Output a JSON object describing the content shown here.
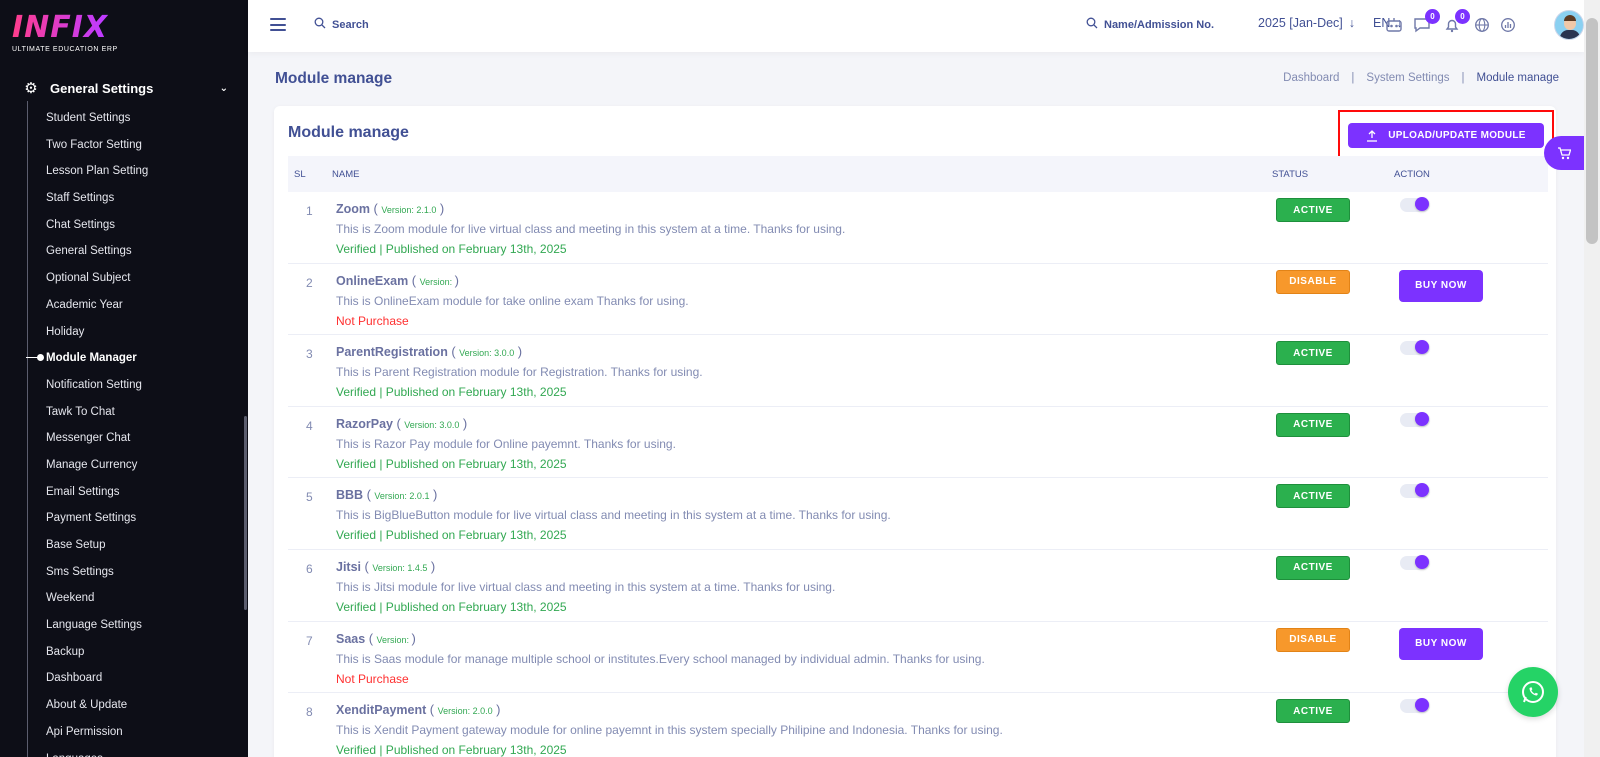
{
  "app": {
    "logo_text": "INFIX",
    "logo_subtitle": "ULTIMATE EDUCATION ERP"
  },
  "sidebar": {
    "section_label": "General Settings",
    "items": [
      {
        "label": "Student Settings"
      },
      {
        "label": "Two Factor Setting"
      },
      {
        "label": "Lesson Plan Setting"
      },
      {
        "label": "Staff Settings"
      },
      {
        "label": "Chat Settings"
      },
      {
        "label": "General Settings"
      },
      {
        "label": "Optional Subject"
      },
      {
        "label": "Academic Year"
      },
      {
        "label": "Holiday"
      },
      {
        "label": "Module Manager",
        "active": true
      },
      {
        "label": "Notification Setting"
      },
      {
        "label": "Tawk To Chat"
      },
      {
        "label": "Messenger Chat"
      },
      {
        "label": "Manage Currency"
      },
      {
        "label": "Email Settings"
      },
      {
        "label": "Payment Settings"
      },
      {
        "label": "Base Setup"
      },
      {
        "label": "Sms Settings"
      },
      {
        "label": "Weekend"
      },
      {
        "label": "Language Settings"
      },
      {
        "label": "Backup"
      },
      {
        "label": "Dashboard"
      },
      {
        "label": "About & Update"
      },
      {
        "label": "Api Permission"
      },
      {
        "label": "Languages"
      }
    ]
  },
  "header": {
    "search_label": "Search",
    "name_search_label": "Name/Admission No.",
    "session": "2025 [Jan-Dec]",
    "language": "EN",
    "chat_count": "0",
    "notification_count": "0"
  },
  "page": {
    "title": "Module manage",
    "breadcrumb": [
      "Dashboard",
      "System Settings",
      "Module manage"
    ]
  },
  "card": {
    "title": "Module manage",
    "upload_button": "UPLOAD/UPDATE MODULE",
    "columns": {
      "sl": "SL",
      "name": "NAME",
      "status": "STATUS",
      "action": "ACTION"
    }
  },
  "modules": [
    {
      "sl": "1",
      "name": "Zoom",
      "version": "Version: 2.1.0",
      "description": "This is Zoom module for live virtual class and meeting in this system at a time. Thanks for using.",
      "verified": "Verified | Published on February 13th, 2025",
      "status": "ACTIVE",
      "purchased": true
    },
    {
      "sl": "2",
      "name": "OnlineExam",
      "version": "Version: ",
      "description": "This is OnlineExam module for take online exam Thanks for using.",
      "verified": "Not Purchase",
      "status": "DISABLE",
      "purchased": false,
      "action_label": "BUY NOW"
    },
    {
      "sl": "3",
      "name": "ParentRegistration",
      "version": "Version: 3.0.0",
      "description": "This is Parent Registration module for Registration. Thanks for using.",
      "verified": "Verified | Published on February 13th, 2025",
      "status": "ACTIVE",
      "purchased": true
    },
    {
      "sl": "4",
      "name": "RazorPay",
      "version": "Version: 3.0.0",
      "description": "This is Razor Pay module for Online payemnt. Thanks for using.",
      "verified": "Verified | Published on February 13th, 2025",
      "status": "ACTIVE",
      "purchased": true
    },
    {
      "sl": "5",
      "name": "BBB",
      "version": "Version: 2.0.1",
      "description": "This is BigBlueButton module for live virtual class and meeting in this system at a time. Thanks for using.",
      "verified": "Verified | Published on February 13th, 2025",
      "status": "ACTIVE",
      "purchased": true
    },
    {
      "sl": "6",
      "name": "Jitsi",
      "version": "Version: 1.4.5",
      "description": "This is Jitsi module for live virtual class and meeting in this system at a time. Thanks for using.",
      "verified": "Verified | Published on February 13th, 2025",
      "status": "ACTIVE",
      "purchased": true
    },
    {
      "sl": "7",
      "name": "Saas",
      "version": "Version: ",
      "description": "This is Saas module for manage multiple school or institutes.Every school managed by individual admin. Thanks for using.",
      "verified": "Not Purchase",
      "status": "DISABLE",
      "purchased": false,
      "action_label": "BUY NOW"
    },
    {
      "sl": "8",
      "name": "XenditPayment",
      "version": "Version: 2.0.0",
      "description": "This is Xendit Payment gateway module for online payemnt in this system specially Philipine and Indonesia. Thanks for using.",
      "verified": "Verified | Published on February 13th, 2025",
      "status": "ACTIVE",
      "purchased": true
    }
  ],
  "colors": {
    "accent": "#7c32ff",
    "active": "#2bb04e",
    "disable": "#f7982b",
    "sidebar_bg": "#0d0e17",
    "highlight": "#ff0a0a"
  }
}
